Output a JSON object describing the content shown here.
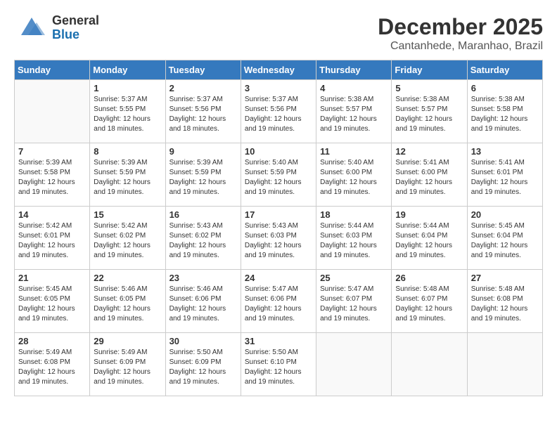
{
  "header": {
    "logo_general": "General",
    "logo_blue": "Blue",
    "month": "December 2025",
    "location": "Cantanhede, Maranhao, Brazil"
  },
  "calendar": {
    "days_of_week": [
      "Sunday",
      "Monday",
      "Tuesday",
      "Wednesday",
      "Thursday",
      "Friday",
      "Saturday"
    ],
    "weeks": [
      [
        {
          "day": "",
          "info": ""
        },
        {
          "day": "1",
          "info": "Sunrise: 5:37 AM\nSunset: 5:55 PM\nDaylight: 12 hours\nand 18 minutes."
        },
        {
          "day": "2",
          "info": "Sunrise: 5:37 AM\nSunset: 5:56 PM\nDaylight: 12 hours\nand 18 minutes."
        },
        {
          "day": "3",
          "info": "Sunrise: 5:37 AM\nSunset: 5:56 PM\nDaylight: 12 hours\nand 19 minutes."
        },
        {
          "day": "4",
          "info": "Sunrise: 5:38 AM\nSunset: 5:57 PM\nDaylight: 12 hours\nand 19 minutes."
        },
        {
          "day": "5",
          "info": "Sunrise: 5:38 AM\nSunset: 5:57 PM\nDaylight: 12 hours\nand 19 minutes."
        },
        {
          "day": "6",
          "info": "Sunrise: 5:38 AM\nSunset: 5:58 PM\nDaylight: 12 hours\nand 19 minutes."
        }
      ],
      [
        {
          "day": "7",
          "info": "Sunrise: 5:39 AM\nSunset: 5:58 PM\nDaylight: 12 hours\nand 19 minutes."
        },
        {
          "day": "8",
          "info": "Sunrise: 5:39 AM\nSunset: 5:59 PM\nDaylight: 12 hours\nand 19 minutes."
        },
        {
          "day": "9",
          "info": "Sunrise: 5:39 AM\nSunset: 5:59 PM\nDaylight: 12 hours\nand 19 minutes."
        },
        {
          "day": "10",
          "info": "Sunrise: 5:40 AM\nSunset: 5:59 PM\nDaylight: 12 hours\nand 19 minutes."
        },
        {
          "day": "11",
          "info": "Sunrise: 5:40 AM\nSunset: 6:00 PM\nDaylight: 12 hours\nand 19 minutes."
        },
        {
          "day": "12",
          "info": "Sunrise: 5:41 AM\nSunset: 6:00 PM\nDaylight: 12 hours\nand 19 minutes."
        },
        {
          "day": "13",
          "info": "Sunrise: 5:41 AM\nSunset: 6:01 PM\nDaylight: 12 hours\nand 19 minutes."
        }
      ],
      [
        {
          "day": "14",
          "info": "Sunrise: 5:42 AM\nSunset: 6:01 PM\nDaylight: 12 hours\nand 19 minutes."
        },
        {
          "day": "15",
          "info": "Sunrise: 5:42 AM\nSunset: 6:02 PM\nDaylight: 12 hours\nand 19 minutes."
        },
        {
          "day": "16",
          "info": "Sunrise: 5:43 AM\nSunset: 6:02 PM\nDaylight: 12 hours\nand 19 minutes."
        },
        {
          "day": "17",
          "info": "Sunrise: 5:43 AM\nSunset: 6:03 PM\nDaylight: 12 hours\nand 19 minutes."
        },
        {
          "day": "18",
          "info": "Sunrise: 5:44 AM\nSunset: 6:03 PM\nDaylight: 12 hours\nand 19 minutes."
        },
        {
          "day": "19",
          "info": "Sunrise: 5:44 AM\nSunset: 6:04 PM\nDaylight: 12 hours\nand 19 minutes."
        },
        {
          "day": "20",
          "info": "Sunrise: 5:45 AM\nSunset: 6:04 PM\nDaylight: 12 hours\nand 19 minutes."
        }
      ],
      [
        {
          "day": "21",
          "info": "Sunrise: 5:45 AM\nSunset: 6:05 PM\nDaylight: 12 hours\nand 19 minutes."
        },
        {
          "day": "22",
          "info": "Sunrise: 5:46 AM\nSunset: 6:05 PM\nDaylight: 12 hours\nand 19 minutes."
        },
        {
          "day": "23",
          "info": "Sunrise: 5:46 AM\nSunset: 6:06 PM\nDaylight: 12 hours\nand 19 minutes."
        },
        {
          "day": "24",
          "info": "Sunrise: 5:47 AM\nSunset: 6:06 PM\nDaylight: 12 hours\nand 19 minutes."
        },
        {
          "day": "25",
          "info": "Sunrise: 5:47 AM\nSunset: 6:07 PM\nDaylight: 12 hours\nand 19 minutes."
        },
        {
          "day": "26",
          "info": "Sunrise: 5:48 AM\nSunset: 6:07 PM\nDaylight: 12 hours\nand 19 minutes."
        },
        {
          "day": "27",
          "info": "Sunrise: 5:48 AM\nSunset: 6:08 PM\nDaylight: 12 hours\nand 19 minutes."
        }
      ],
      [
        {
          "day": "28",
          "info": "Sunrise: 5:49 AM\nSunset: 6:08 PM\nDaylight: 12 hours\nand 19 minutes."
        },
        {
          "day": "29",
          "info": "Sunrise: 5:49 AM\nSunset: 6:09 PM\nDaylight: 12 hours\nand 19 minutes."
        },
        {
          "day": "30",
          "info": "Sunrise: 5:50 AM\nSunset: 6:09 PM\nDaylight: 12 hours\nand 19 minutes."
        },
        {
          "day": "31",
          "info": "Sunrise: 5:50 AM\nSunset: 6:10 PM\nDaylight: 12 hours\nand 19 minutes."
        },
        {
          "day": "",
          "info": ""
        },
        {
          "day": "",
          "info": ""
        },
        {
          "day": "",
          "info": ""
        }
      ]
    ]
  }
}
